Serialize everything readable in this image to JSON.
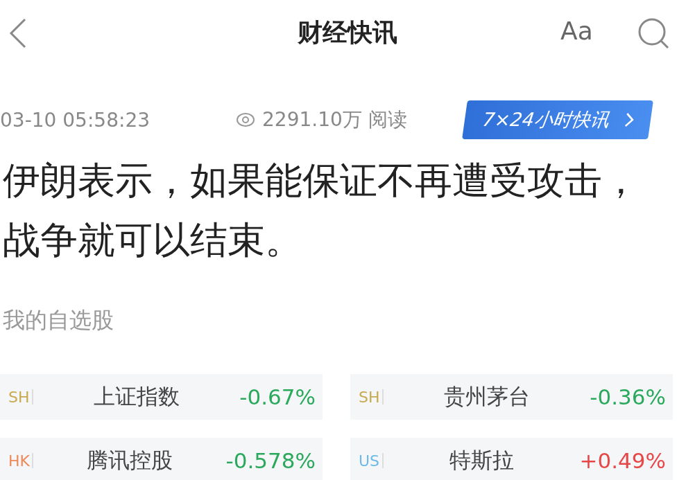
{
  "header": {
    "title": "财经快讯",
    "font_button": "Aa"
  },
  "meta": {
    "time": "03-10 05:58:23",
    "views": "2291.10万 阅读",
    "badge": "7×24小时快讯"
  },
  "headline": "伊朗表示，如果能保证不再遭受攻击，战争就可以结束。",
  "watchlist": {
    "title": "我的自选股",
    "stocks": [
      {
        "market": "SH",
        "color": "#c9a94e",
        "name": "上证指数",
        "change": "-0.67%",
        "kind": "down"
      },
      {
        "market": "SH",
        "color": "#c9a94e",
        "name": "贵州茅台",
        "change": "-0.36%",
        "kind": "down"
      },
      {
        "market": "HK",
        "color": "#f0895a",
        "name": "腾讯控股",
        "change": "-0.578%",
        "kind": "down"
      },
      {
        "market": "US",
        "color": "#6cb9ea",
        "name": "特斯拉",
        "change": "+0.49%",
        "kind": "up"
      }
    ]
  }
}
